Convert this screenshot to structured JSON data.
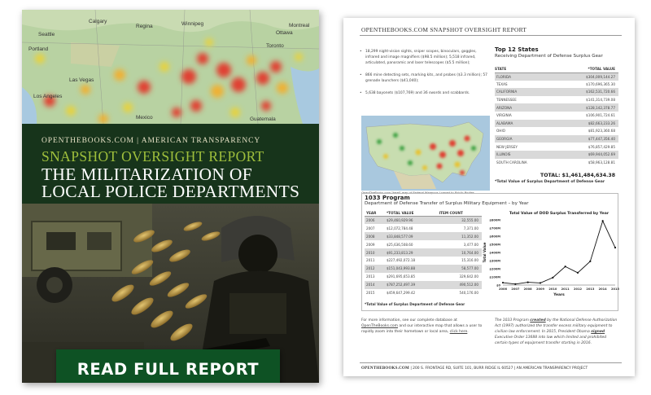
{
  "cover": {
    "brand": "OPENTHEBOOKS.COM | AMERICAN TRANSPARENCY",
    "kicker": "SNAPSHOT OVERSIGHT REPORT",
    "title_line1": "THE MILITARIZATION OF",
    "title_line2": "LOCAL POLICE DEPARTMENTS",
    "map_labels": [
      "Calgary",
      "Regina",
      "Winnipeg",
      "Seattle",
      "Ottawa",
      "Portland",
      "Montreal",
      "Toronto",
      "Las Vegas",
      "Los Angeles",
      "Mexico",
      "Guatemala"
    ],
    "cta_label": "READ FULL REPORT",
    "accent": "#9fbf3c",
    "band_color": "#17341b",
    "cta_color": "#0e5224"
  },
  "report": {
    "header": "OPENTHEBOOKS.COM SNAPSHOT OVERSIGHT REPORT",
    "bullets": [
      "18,299 night-vision sights, sniper scopes, binoculars, goggles, infrared and image magnifiers ($98.5 million); 5,518 infrared, articulated, panoramic and laser telescopes ($5.5 million);",
      "866 mine detecting sets, marking kits, and probes ($3.3 million); 57 grenade launchers ($41,040);",
      "5,638 bayonets ($107,769) and 36 swords and scabbards."
    ],
    "map_caption": "OpenTheBooks.com \"heat\" map of Federal Weapons Loaned to Public Bodies.",
    "top12": {
      "title": "Top 12 States",
      "subtitle": "Receiving Department of Defense Surplus Gear",
      "col_state": "STATE",
      "col_value": "*TOTAL VALUE",
      "rows": [
        {
          "state": "FLORIDA",
          "value": "$304,009,144.27"
        },
        {
          "state": "TEXAS",
          "value": "$170,696,365.30"
        },
        {
          "state": "CALIFORNIA",
          "value": "$162,531,720.66"
        },
        {
          "state": "TENNESSEE",
          "value": "$141,314,739.08"
        },
        {
          "state": "ARIZONA",
          "value": "$128,142,378.77"
        },
        {
          "state": "VIRGINIA",
          "value": "$106,901,724.61"
        },
        {
          "state": "ALABAMA",
          "value": "$82,663,233.26"
        },
        {
          "state": "OHIO",
          "value": "$81,923,360.68"
        },
        {
          "state": "GEORGIA",
          "value": "$77,447,356.40"
        },
        {
          "state": "NEW JERSEY",
          "value": "$76,857,429.85"
        },
        {
          "state": "ILLINOIS",
          "value": "$69,944,052.69"
        },
        {
          "state": "SOUTH CAROLINA",
          "value": "$58,963,128.81"
        }
      ],
      "total": "TOTAL: $1,461,484,634.38",
      "note": "*Total Value of Surplus Department of Defense Gear"
    },
    "program": {
      "title": "1033 Program",
      "subtitle": "Department of Defense Transfer of Surplus Military Equipment – by Year",
      "col_year": "YEAR",
      "col_value": "*TOTAL VALUE",
      "col_count": "ITEM COUNT",
      "rows": [
        {
          "year": "2006",
          "value": "$29,460,929.96",
          "count": "32,555.00"
        },
        {
          "year": "2007",
          "value": "$12,072,784.48",
          "count": "7,371.00"
        },
        {
          "year": "2008",
          "value": "$33,848,577.09",
          "count": "11,352.00"
        },
        {
          "year": "2009",
          "value": "$25,636,508.60",
          "count": "3,477.00"
        },
        {
          "year": "2010",
          "value": "$91,233,813.29",
          "count": "10,764.00"
        },
        {
          "year": "2011",
          "value": "$227,492,072.18",
          "count": "15,316.00"
        },
        {
          "year": "2012",
          "value": "$151,043,993.88",
          "count": "58,577.00"
        },
        {
          "year": "2013",
          "value": "$291,695,653.85",
          "count": "329,642.00"
        },
        {
          "year": "2014",
          "value": "$787,252,497.39",
          "count": "490,512.00"
        },
        {
          "year": "2015",
          "value": "$459,647,299.42",
          "count": "540,176.00"
        }
      ],
      "note": "*Total Value of Surplus Department of Defense Gear"
    },
    "para_left": {
      "text1": "For more information, see our complete database at ",
      "link1": "OpenTheBooks.com",
      "text2": " and our interactive map that allows a user to rapidly zoom into their hometown or local area, ",
      "link2": "click here",
      "text3": "."
    },
    "para_right": {
      "text1": "The 1033 Program ",
      "em1": "created",
      "text2": " by the National Defense Authorization Act (1997) authorized the transfer excess military equipment to civilian law enforcement. In 2015, President Obama ",
      "em2": "signed",
      "text3": " Executive Order 13688 into law which limited and prohibited certain types of equipment transfer starting in 2016."
    },
    "footer_brand": "OPENTHEBOOKS.COM",
    "footer_text": "| 200 S. FRONTAGE RD, SUITE 101, BURR RIDGE IL 60527 |",
    "footer_project": "AN AMERICAN TRANSPARENCY PROJECT"
  },
  "chart_data": {
    "type": "line",
    "title": "Total Value of DOD Surplus Transferred by Year",
    "xlabel": "Years",
    "ylabel": "Total Value",
    "x": [
      "2006",
      "2007",
      "2008",
      "2009",
      "2010",
      "2011",
      "2012",
      "2013",
      "2014",
      "2015"
    ],
    "series": [
      {
        "values": [
          29.46,
          12.07,
          33.85,
          25.64,
          91.23,
          227.49,
          151.04,
          291.7,
          787.25,
          459.65
        ]
      }
    ],
    "yticks": [
      "$0",
      "$100M",
      "$200M",
      "$300M",
      "$400M",
      "$500M",
      "$600M",
      "$700M",
      "$800M"
    ],
    "ylim": [
      0,
      800
    ],
    "grid": false,
    "line_color": "#111111"
  }
}
